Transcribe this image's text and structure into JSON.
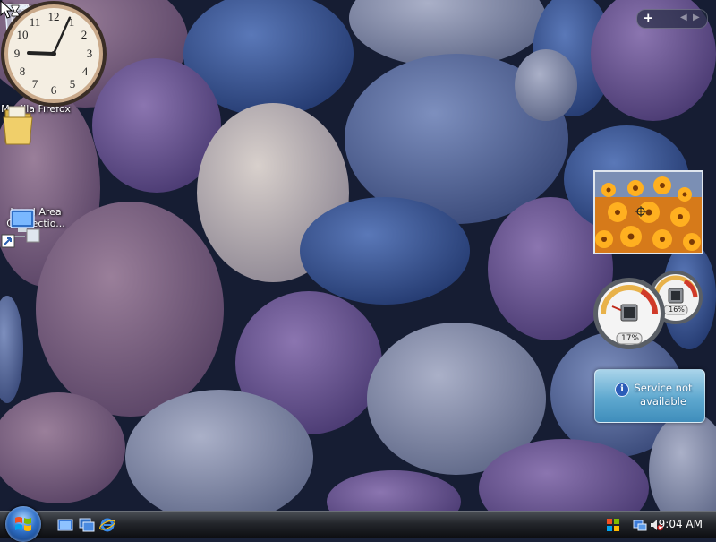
{
  "desktop": {
    "icons": [
      {
        "label": "Recycle Bin"
      },
      {
        "label": "Mozilla Firefox"
      },
      {
        "label": "Local Area Connectio..."
      }
    ]
  },
  "gadgets": {
    "cpu_meter": {
      "cpu_percent": "17%",
      "memory_percent": "16%"
    },
    "clock": {
      "hour": 9,
      "minute": 4
    },
    "weather": {
      "message": "Service not available"
    }
  },
  "taskbar": {
    "clock_text": "9:04 AM"
  },
  "colors": {
    "taskbar": "#1b1d22",
    "weather_panel": "#5ea8cf"
  }
}
